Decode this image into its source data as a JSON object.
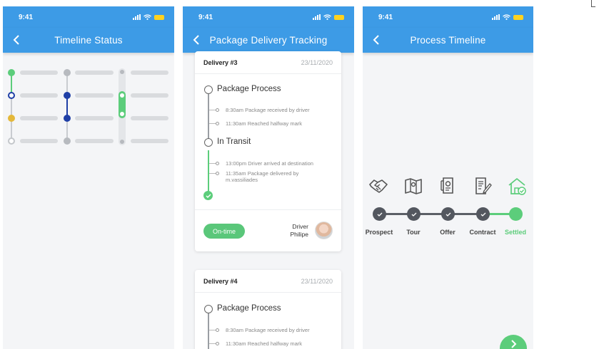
{
  "status_bar": {
    "time": "9:41"
  },
  "screens": [
    {
      "title": "Timeline Status"
    },
    {
      "title": "Package Delivery Tracking"
    },
    {
      "title": "Process Timeline"
    }
  ],
  "delivery_cards": [
    {
      "title": "Delivery #3",
      "date": "23/11/2020",
      "stages": [
        {
          "name": "Package Process",
          "events": [
            "8:30am Package received by driver",
            "11:30am Reached halfway mark"
          ]
        },
        {
          "name": "In Transit",
          "events": [
            "13:00pm Driver arrived at destination",
            "11:35am Package delivered by",
            "m.vassiliades"
          ]
        }
      ],
      "status_label": "On-time",
      "driver_label": "Driver",
      "driver_name": "Philipe"
    },
    {
      "title": "Delivery #4",
      "date": "23/11/2020",
      "stages": [
        {
          "name": "Package Process",
          "events": [
            "8:30am Package received by driver",
            "11:30am Reached halfway mark"
          ]
        }
      ]
    }
  ],
  "process_steps": [
    {
      "label": "Prospect",
      "icon": "handshake-icon",
      "done": true
    },
    {
      "label": "Tour",
      "icon": "map-icon",
      "done": true
    },
    {
      "label": "Offer",
      "icon": "offer-document-icon",
      "done": true
    },
    {
      "label": "Contract",
      "icon": "contract-icon",
      "done": true
    },
    {
      "label": "Settled",
      "icon": "house-check-icon",
      "done": true,
      "active": true
    }
  ],
  "colors": {
    "app_bar": "#3d9be6",
    "green": "#5ccd7b",
    "blue_dot": "#1f3fa6",
    "yellow_dot": "#e4b83a",
    "dark_step": "#53575f"
  }
}
